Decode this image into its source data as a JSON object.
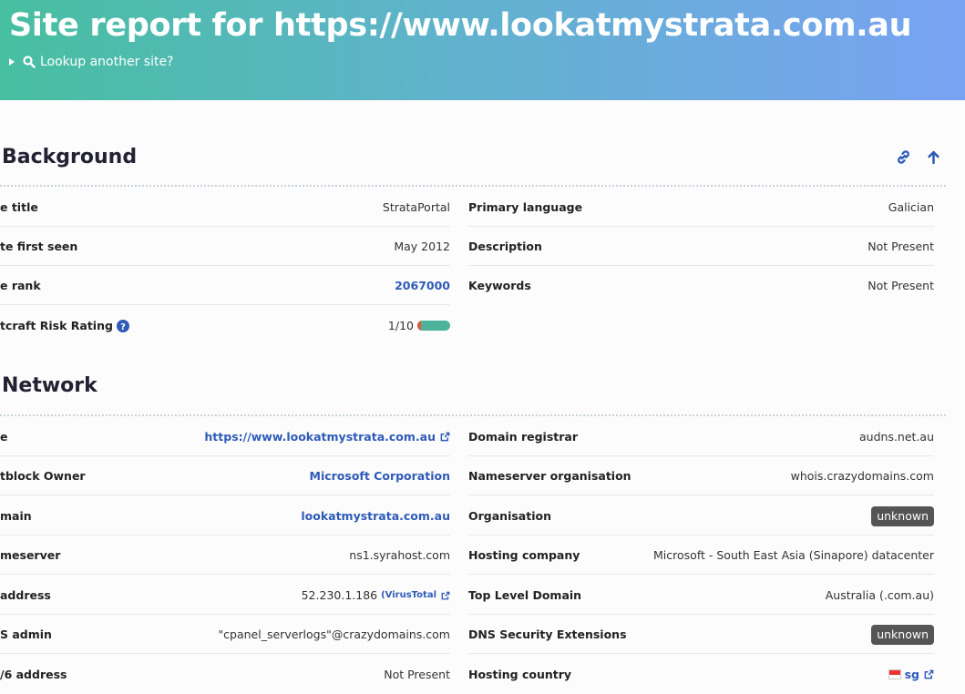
{
  "header": {
    "title": "Site report for https://www.lookatmystrata.com.au",
    "lookup_label": "Lookup another site?"
  },
  "background": {
    "title": "Background",
    "left": [
      {
        "label": "e title",
        "value": "StrataPortal"
      },
      {
        "label": "te first seen",
        "value": "May 2012"
      },
      {
        "label": "e rank",
        "value": "2067000"
      },
      {
        "label": "tcraft Risk Rating",
        "value": "1/10"
      }
    ],
    "risk_rating_fraction": 0.1,
    "right": [
      {
        "label": "Primary language",
        "value": "Galician"
      },
      {
        "label": "Description",
        "value": "Not Present"
      },
      {
        "label": "Keywords",
        "value": "Not Present"
      }
    ]
  },
  "network": {
    "title": "Network",
    "left": [
      {
        "label": "e",
        "value": "https://www.lookatmystrata.com.au"
      },
      {
        "label": "tblock Owner",
        "value": "Microsoft Corporation"
      },
      {
        "label": "main",
        "value": "lookatmystrata.com.au"
      },
      {
        "label": "meserver",
        "value": "ns1.syrahost.com"
      },
      {
        "label": "address",
        "value": "52.230.1.186",
        "extra": "(VirusTotal"
      },
      {
        "label": "S admin",
        "value": "\"cpanel_serverlogs\"@crazydomains.com"
      },
      {
        "label": "/6 address",
        "value": "Not Present"
      }
    ],
    "right": [
      {
        "label": "Domain registrar",
        "value": "audns.net.au"
      },
      {
        "label": "Nameserver organisation",
        "value": "whois.crazydomains.com"
      },
      {
        "label": "Organisation",
        "value": "unknown"
      },
      {
        "label": "Hosting company",
        "value": "Microsoft - South East Asia (Sinapore) datacenter"
      },
      {
        "label": "Top Level Domain",
        "value": "Australia (.com.au)"
      },
      {
        "label": "DNS Security Extensions",
        "value": "unknown"
      },
      {
        "label": "Hosting country",
        "value": "sg"
      }
    ]
  },
  "colors": {
    "link": "#2e5bb8",
    "badge_bg": "#555555",
    "risk_low": "#4db39a",
    "risk_high": "#e4553b",
    "header_gradient_start": "#47bfa0",
    "header_gradient_end": "#79a2f3"
  },
  "icons": [
    "search-icon",
    "link-icon",
    "arrow-up-icon",
    "help-icon",
    "external-link-icon",
    "flag-icon"
  ]
}
